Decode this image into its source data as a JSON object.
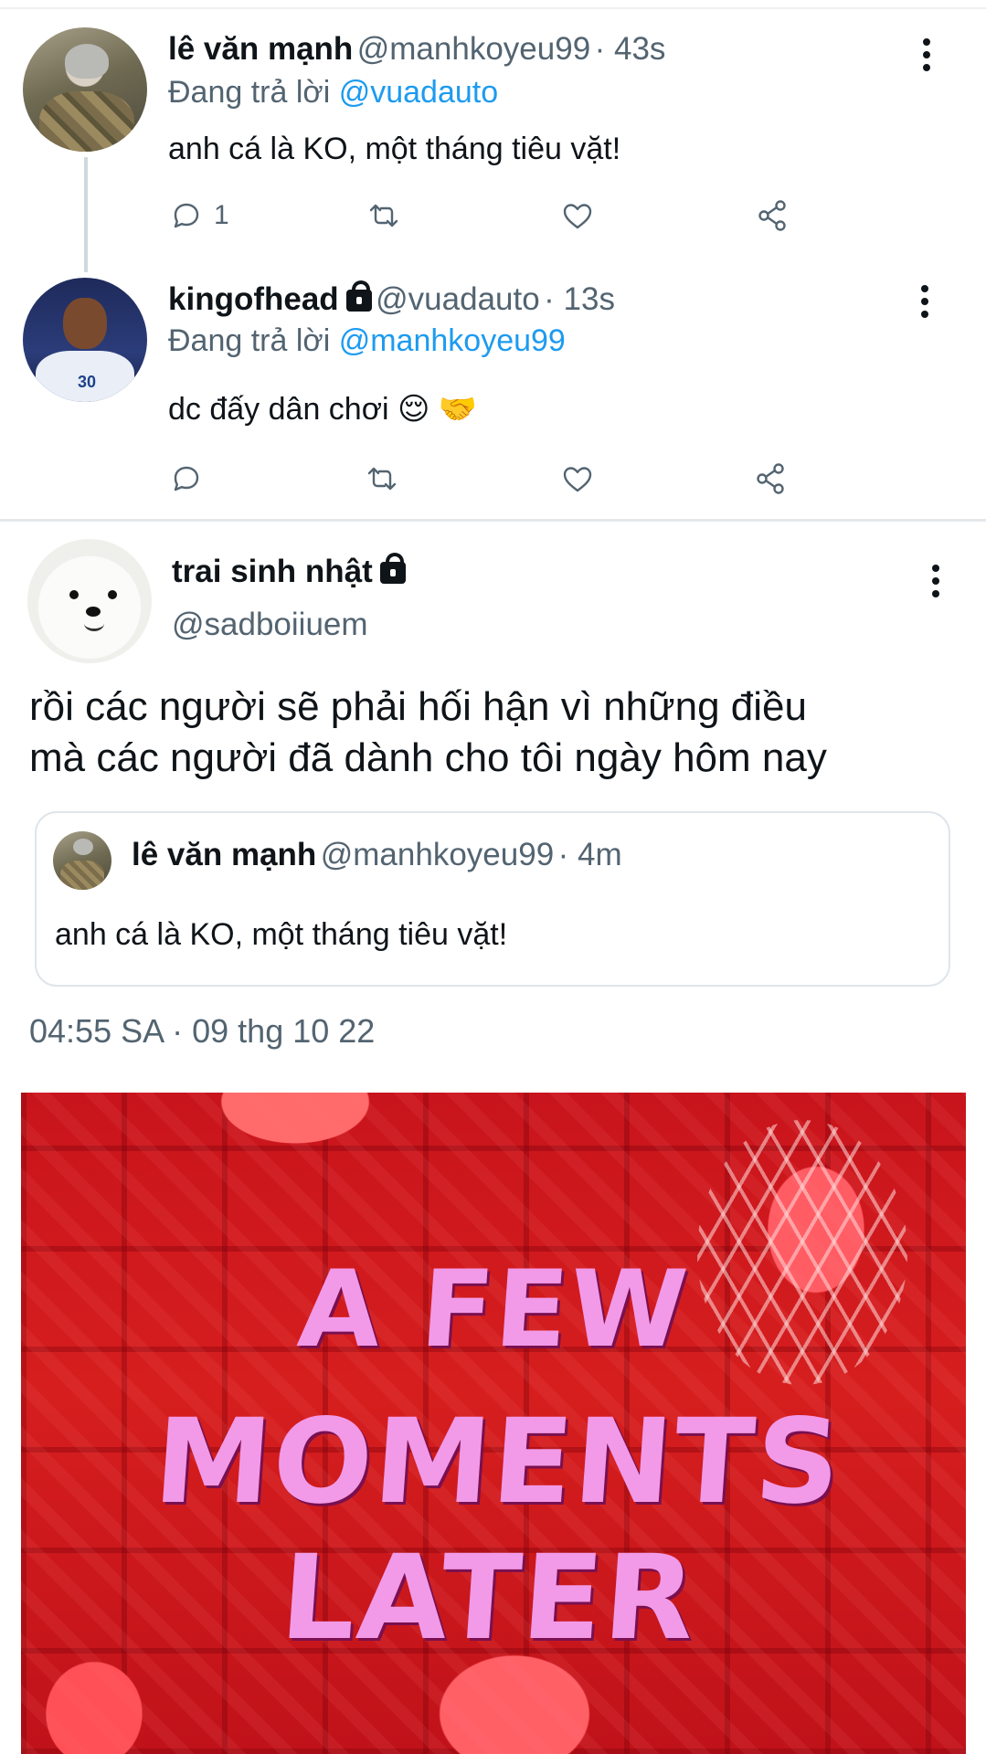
{
  "thread": [
    {
      "display_name": "lê văn mạnh",
      "handle": "@manhkoyeu99",
      "time": "· 43s",
      "replying_prefix": "Đang trả lời",
      "replying_to": "@vuadauto",
      "text": "anh cá là KO, một tháng tiêu vặt!",
      "reply_count": "1",
      "protected": false
    },
    {
      "display_name": "kingofhead",
      "handle": "@vuadauto",
      "time": "· 13s",
      "replying_prefix": "Đang trả lời",
      "replying_to": "@manhkoyeu99",
      "text": "dc đấy dân chơi 😌 🤝",
      "reply_count": "",
      "protected": true
    }
  ],
  "main_tweet": {
    "display_name": "trai sinh nhật",
    "handle": "@sadboiiuem",
    "text_line1": "rồi các người sẽ phải hối hận vì những điều",
    "text_line2": "mà các người đã dành cho tôi ngày hôm nay",
    "quote": {
      "display_name": "lê văn mạnh",
      "handle": "@manhkoyeu99",
      "time": "· 4m",
      "text": "anh cá là KO, một tháng tiêu vặt!"
    },
    "timestamp": "04:55 SA · 09 thg 10 22",
    "media_caption_line1": "A FEW",
    "media_caption_line2": "MOMENTS LATER"
  },
  "icons": {
    "reply": "reply-icon",
    "retweet": "retweet-icon",
    "like": "heart-icon",
    "share": "share-icon",
    "more": "more-options-icon",
    "protected": "lock-icon"
  },
  "colors": {
    "link": "#1d9bf0",
    "secondary_text": "#536471",
    "primary_text": "#0f1419"
  }
}
